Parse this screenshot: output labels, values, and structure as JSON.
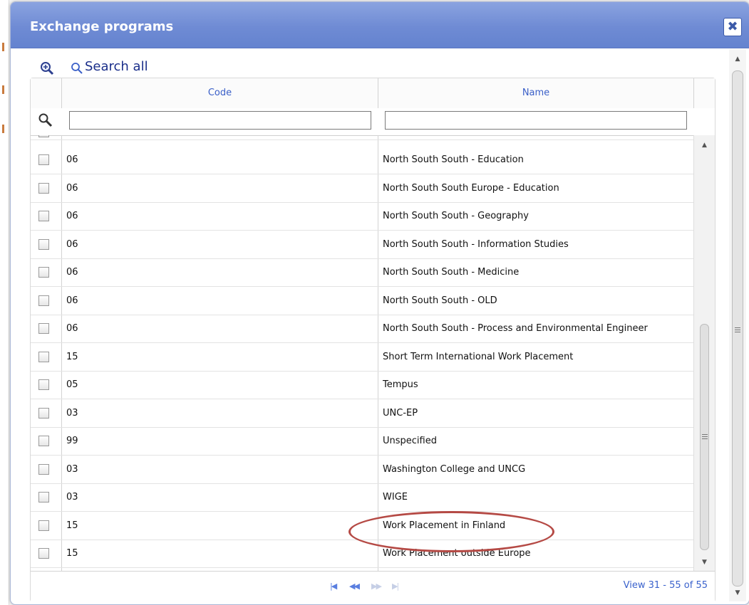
{
  "dialog": {
    "title": "Exchange programs",
    "close_label": "✖"
  },
  "toolbar": {
    "search_all_label": "Search all"
  },
  "grid": {
    "columns": [
      "Code",
      "Name"
    ],
    "filters": {
      "code": "",
      "name": ""
    },
    "rows": [
      {
        "code": "06",
        "name": "North South South - Education"
      },
      {
        "code": "06",
        "name": "North South South Europe - Education"
      },
      {
        "code": "06",
        "name": "North South South - Geography"
      },
      {
        "code": "06",
        "name": "North South South - Information Studies"
      },
      {
        "code": "06",
        "name": "North South South - Medicine"
      },
      {
        "code": "06",
        "name": "North South South - OLD"
      },
      {
        "code": "06",
        "name": "North South South - Process and Environmental Engineer"
      },
      {
        "code": "15",
        "name": "Short Term International Work Placement"
      },
      {
        "code": "05",
        "name": "Tempus"
      },
      {
        "code": "03",
        "name": "UNC-EP"
      },
      {
        "code": "99",
        "name": "Unspecified"
      },
      {
        "code": "03",
        "name": "Washington College and UNCG"
      },
      {
        "code": "03",
        "name": "WIGE"
      },
      {
        "code": "15",
        "name": "Work Placement in Finland"
      },
      {
        "code": "15",
        "name": "Work Placement outside Europe"
      }
    ],
    "highlighted_row": "Work Placement in Finland"
  },
  "pager": {
    "first": "|◀",
    "prev": "◀◀",
    "next": "▶▶",
    "last": "▶|",
    "view_info": "View 31 - 55 of 55"
  },
  "colors": {
    "titlebar": "#6f8bd4",
    "link": "#3a5fc8",
    "annotation": "#b54a45"
  }
}
